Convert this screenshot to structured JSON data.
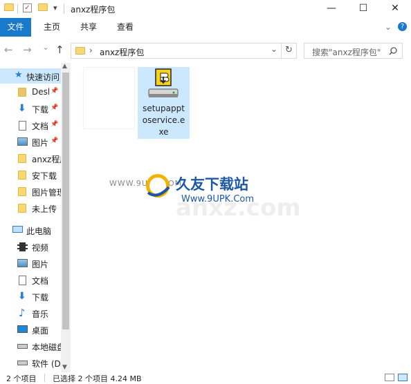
{
  "window": {
    "title": "anxz程序包",
    "controls": {
      "minimize": "—",
      "maximize": "☐",
      "close": "✕"
    }
  },
  "ribbon": {
    "tabs": [
      "文件",
      "主页",
      "共享",
      "查看"
    ],
    "expand_icon": "chevron-down-icon",
    "help_icon": "help-icon"
  },
  "address": {
    "back": "←",
    "forward": "→",
    "recent": "⌄",
    "up": "↑",
    "separator": "›",
    "path": "anxz程序包",
    "dropdown": "⌄",
    "refresh": "↻"
  },
  "search": {
    "placeholder": "搜索\"anxz程序包\""
  },
  "sidebar": {
    "quick_access": "快速访问",
    "items": [
      {
        "label": "Desktop",
        "icon": "folder-icon",
        "pinned": true
      },
      {
        "label": "下载",
        "icon": "download-icon",
        "pinned": true
      },
      {
        "label": "文档",
        "icon": "document-icon",
        "pinned": true
      },
      {
        "label": "图片",
        "icon": "picture-icon",
        "pinned": true
      },
      {
        "label": "anxz程序包",
        "icon": "folder-icon",
        "pinned": false
      },
      {
        "label": "安下载",
        "icon": "folder-icon",
        "pinned": false
      },
      {
        "label": "图片管理",
        "icon": "folder-icon",
        "pinned": false
      },
      {
        "label": "未上传",
        "icon": "folder-icon",
        "pinned": false
      }
    ],
    "this_pc": "此电脑",
    "pc_items": [
      {
        "label": "视频",
        "icon": "video-icon"
      },
      {
        "label": "图片",
        "icon": "picture-icon"
      },
      {
        "label": "文档",
        "icon": "document-icon"
      },
      {
        "label": "下载",
        "icon": "download-icon"
      },
      {
        "label": "音乐",
        "icon": "music-icon"
      },
      {
        "label": "桌面",
        "icon": "desktop-icon"
      },
      {
        "label": "本地磁盘 (C:)",
        "icon": "drive-icon"
      },
      {
        "label": "软件 (D:)",
        "icon": "drive-icon"
      }
    ]
  },
  "files": [
    {
      "name": "",
      "icon": "blank-file-icon"
    },
    {
      "name": "setupapptoservice.exe",
      "name_lines": [
        "setupappt",
        "oservice.e",
        "xe"
      ],
      "icon": "installer-icon"
    }
  ],
  "watermark": {
    "url_left": "WWW.9UPK.COM",
    "brand": "久友下载站",
    "url": "Www.9UPK.Com",
    "bg_text": "anxz.com",
    "colors": {
      "brand": "#1b57a8",
      "accent": "#f2b400"
    }
  },
  "status": {
    "count": "2 个项目",
    "selected": "已选择 2 个项目 4.24 MB"
  },
  "colors": {
    "accent": "#1979ca",
    "selection": "#cce8ff",
    "folder": "#f8d775"
  }
}
